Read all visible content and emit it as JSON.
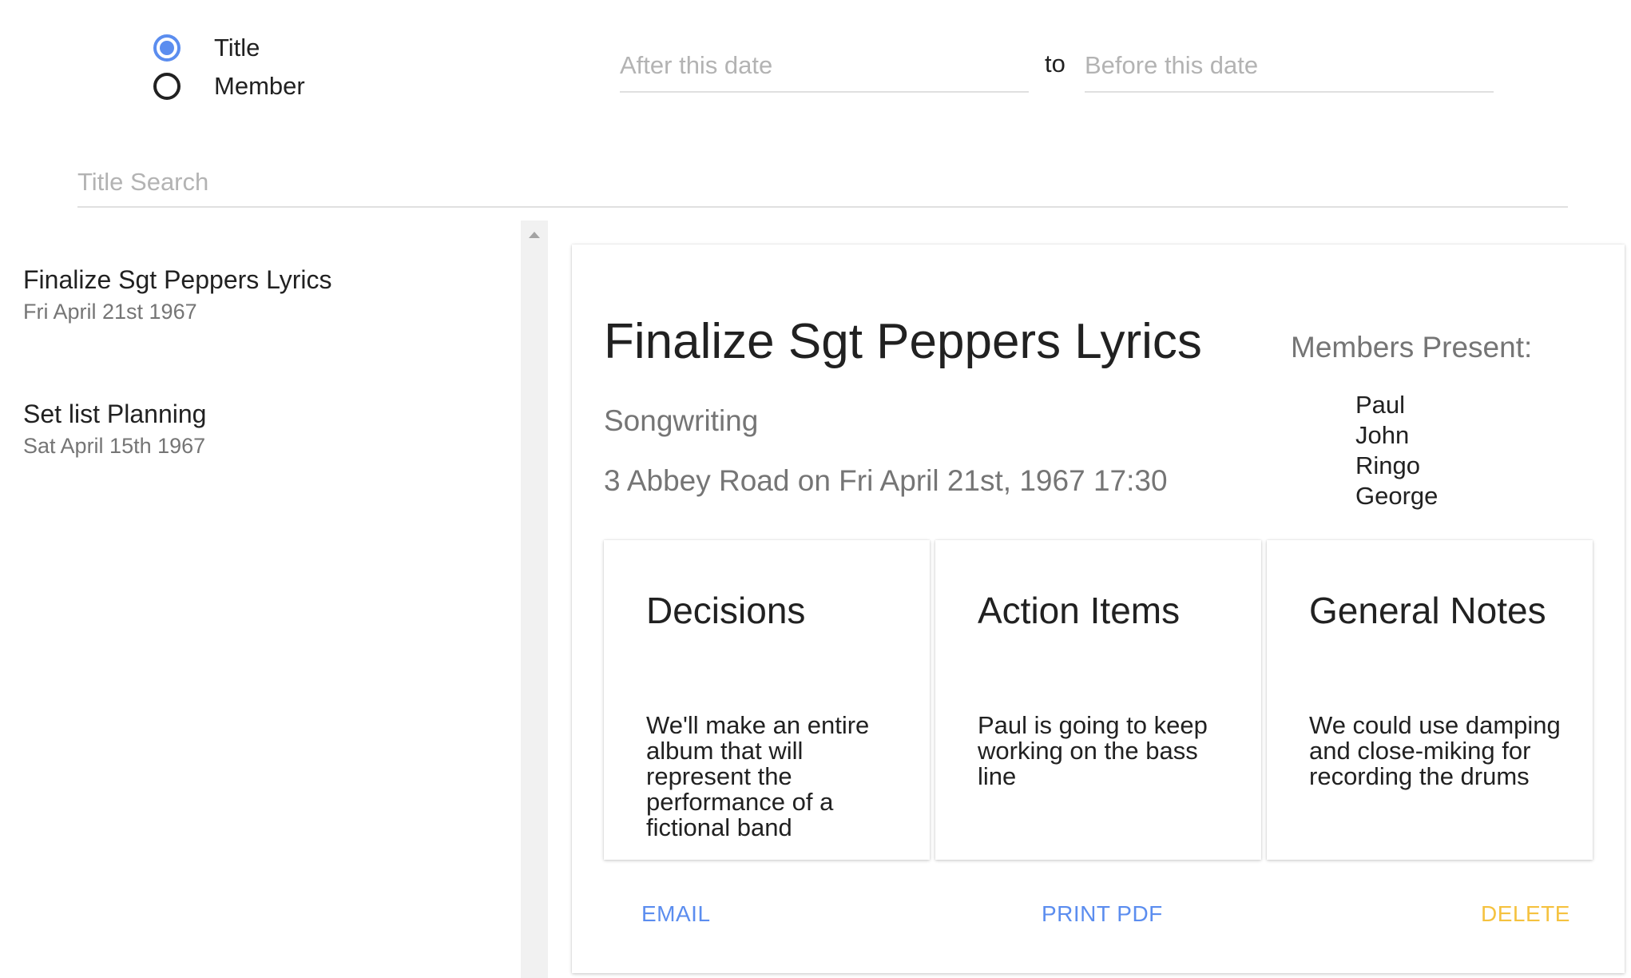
{
  "search_mode": {
    "options": [
      {
        "label": "Title",
        "selected": true
      },
      {
        "label": "Member",
        "selected": false
      }
    ]
  },
  "date_range": {
    "after_placeholder": "After this date",
    "after_value": "",
    "separator": "to",
    "before_placeholder": "Before this date",
    "before_value": ""
  },
  "search": {
    "placeholder": "Title Search",
    "value": ""
  },
  "meetings": [
    {
      "title": "Finalize Sgt Peppers Lyrics",
      "date": "Fri April 21st 1967"
    },
    {
      "title": "Set list Planning",
      "date": "Sat April 15th 1967"
    }
  ],
  "detail": {
    "title": "Finalize Sgt Peppers Lyrics",
    "category": "Songwriting",
    "location": "3 Abbey Road on Fri April 21st, 1967 17:30",
    "members_heading": "Members Present:",
    "members": [
      "Paul",
      "John",
      "Ringo",
      "George"
    ],
    "notes": [
      {
        "heading": "Decisions",
        "body": "We'll make an entire album that will represent the performance of a fictional band"
      },
      {
        "heading": "Action Items",
        "body": "Paul is going to keep working on the bass line"
      },
      {
        "heading": "General Notes",
        "body": "We could use damping and close-miking for recording the drums"
      }
    ],
    "actions": {
      "email": "EMAIL",
      "print": "PRINT PDF",
      "delete": "DELETE"
    }
  },
  "colors": {
    "accent": "#5b8def",
    "warning": "#f5c23f",
    "secondary_text": "#757575",
    "placeholder": "#b3b3b3"
  }
}
